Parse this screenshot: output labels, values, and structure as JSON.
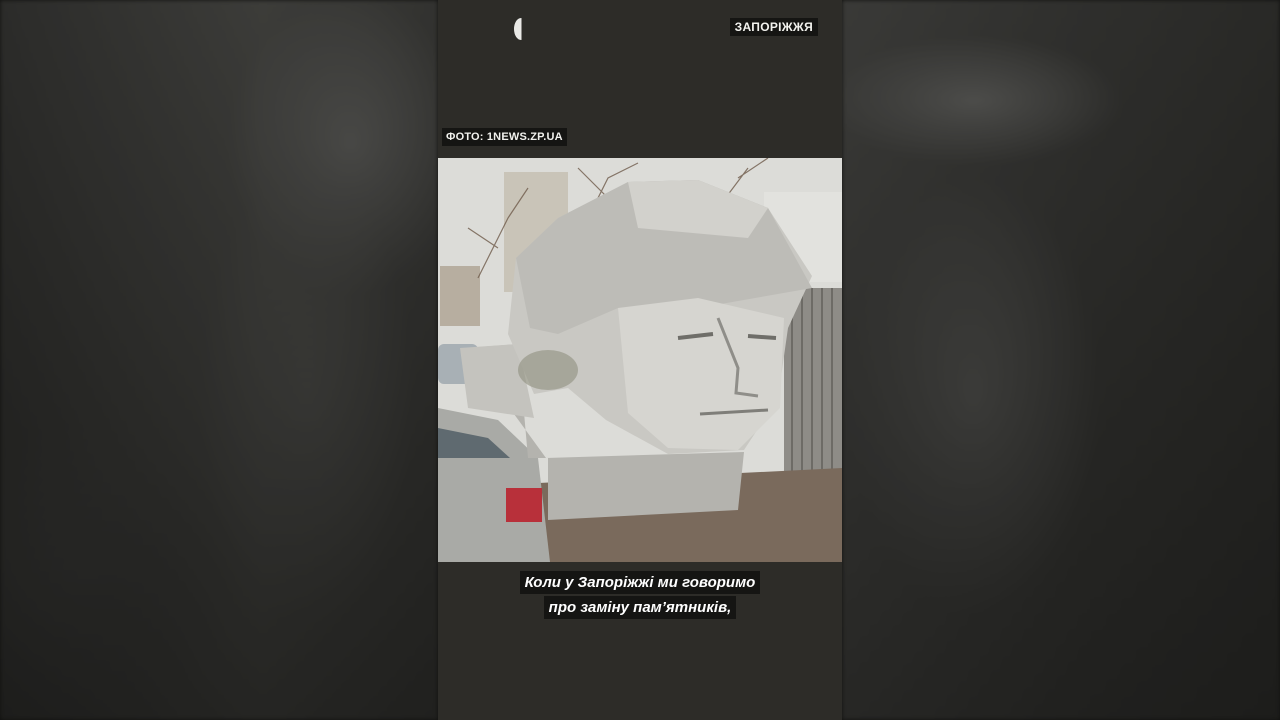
{
  "header": {
    "region_tag": "ЗАПОРІЖЖЯ",
    "logo_icon": "half-circle-logo-icon"
  },
  "photo": {
    "credit": "ФОТО: 1NEWS.ZP.UA"
  },
  "subtitles": {
    "line1": "Коли у Запоріжжі ми говоримо",
    "line2": "про заміну пам’ятників,"
  },
  "colors": {
    "caption_bg": "#151513",
    "column_bg": "#2d2c28",
    "caption_text": "#ffffff"
  }
}
